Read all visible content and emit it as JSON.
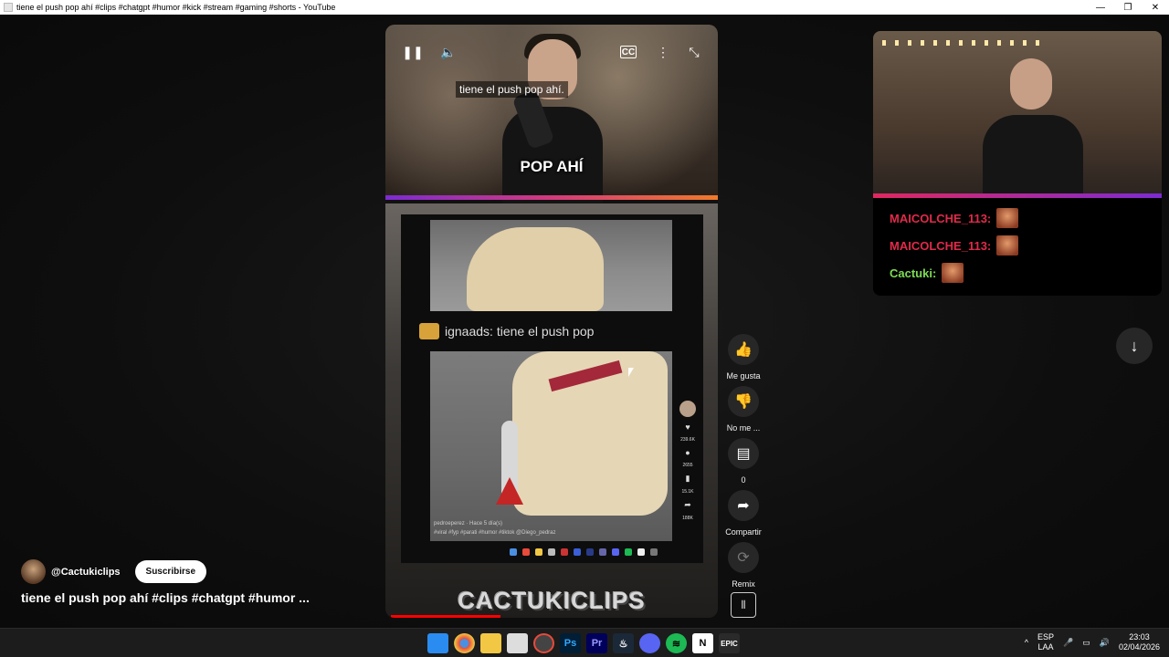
{
  "window": {
    "title": "tiene el push pop ahí #clips #chatgpt #humor #kick #stream #gaming #shorts - YouTube",
    "minimize": "—",
    "restore": "❐",
    "close": "✕"
  },
  "player": {
    "caption": "tiene el push pop ahí.",
    "overlay_text": "POP AHÍ",
    "comment_text": "ignaads: tiene el push pop",
    "brand_text": "CACTUKICLIPS",
    "tiktok_stats": [
      "239.6K",
      "2655",
      "15.1K",
      "188K"
    ],
    "tiktok_user": "pedroeperez · Hace 5 día(s)",
    "tiktok_tags": "#viral #fyp #parati #humor #tiktok @Diego_pedraz"
  },
  "actions": {
    "like": "Me gusta",
    "dislike": "No me ...",
    "comments_count": "0",
    "share": "Compartir",
    "remix": "Remix"
  },
  "channel": {
    "name": "@Cactukiclips",
    "subscribe": "Suscribirse"
  },
  "video_title": "tiene el push pop ahí #clips #chatgpt #humor ...",
  "next_video": {
    "chat": [
      {
        "user": "MAICOLCHE_113:",
        "color": "#e02a4a"
      },
      {
        "user": "MAICOLCHE_113:",
        "color": "#e02a4a"
      },
      {
        "user": "Cactuki:",
        "color": "#7ddc55"
      }
    ]
  },
  "tray": {
    "lang_top": "ESP",
    "lang_bottom": "LAA",
    "time": "23:03",
    "date": "02/04/2026"
  },
  "icons": {
    "pause": "pause-icon",
    "volume": "volume-icon",
    "cc": "closed-captions-icon",
    "more": "more-vert-icon",
    "exit_fullscreen": "exit-fullscreen-icon"
  }
}
